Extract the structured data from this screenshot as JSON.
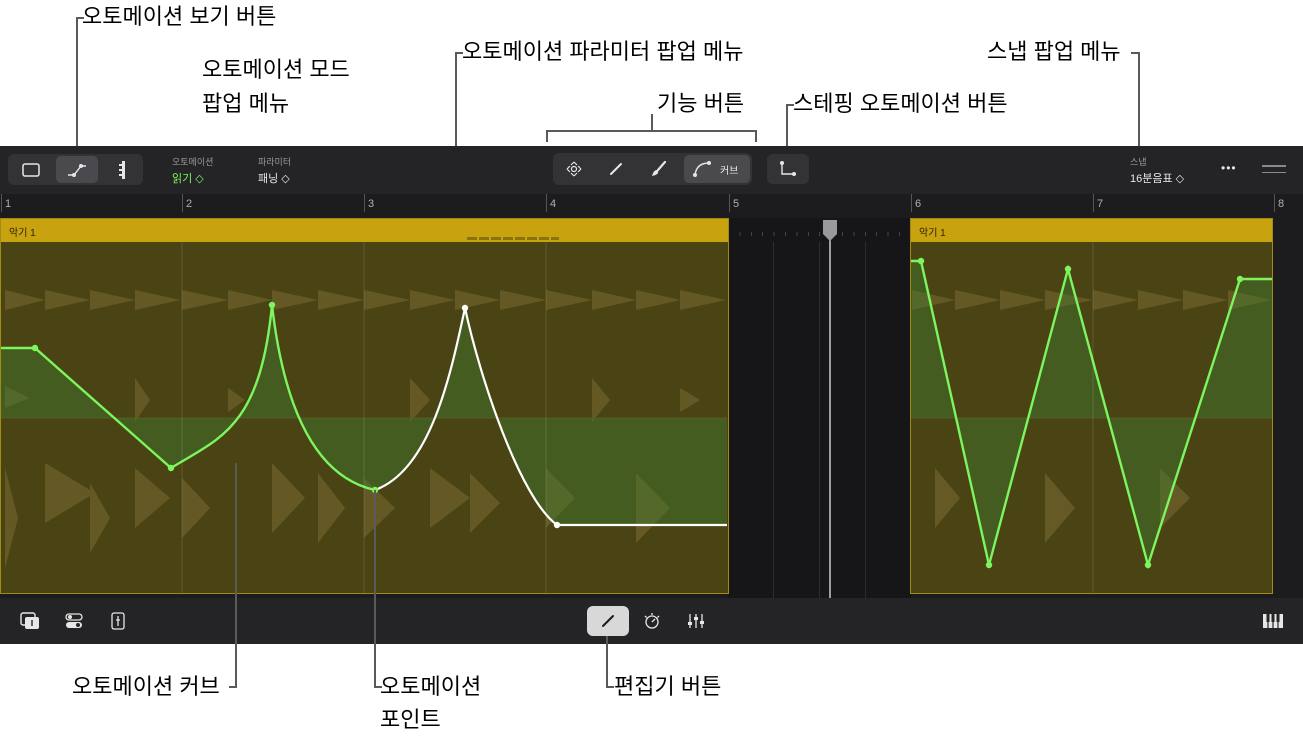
{
  "callouts": {
    "view_button": "오토메이션 보기 버튼",
    "mode_popup_line1": "오토메이션 모드",
    "mode_popup_line2": "팝업 메뉴",
    "parameter_popup": "오토메이션 파라미터 팝업 메뉴",
    "function_buttons": "기능 버튼",
    "stepping_button": "스테핑 오토메이션 버튼",
    "snap_popup": "스냅 팝업 메뉴",
    "curve": "오토메이션 커브",
    "point_line1": "오토메이션",
    "point_line2": "포인트",
    "editor_button": "편집기 버튼"
  },
  "toolbar": {
    "automation_label": "오토메이션",
    "automation_value": "읽기 ◇",
    "parameter_label": "파라미터",
    "parameter_value": "패닝 ◇",
    "curve_label": "커브",
    "snap_label": "스냅",
    "snap_value": "16분음표 ◇",
    "more": "•••"
  },
  "ruler": {
    "bars": [
      "1",
      "2",
      "3",
      "4",
      "5",
      "6",
      "7",
      "8"
    ]
  },
  "regions": [
    {
      "name": "악기 1"
    },
    {
      "name": "악기 1"
    }
  ],
  "colors": {
    "accent_green": "#7cf55e",
    "region_header": "#c9a20f",
    "region_body": "#4a4414",
    "app_bg": "#1c1c1e"
  },
  "icons": [
    "window-icon",
    "automation-icon",
    "piano-roll-icon",
    "move-icon",
    "pencil-icon",
    "brush-icon",
    "curve-icon",
    "step-icon",
    "browser-icon",
    "toggle-icon",
    "inspector-icon",
    "editor-icon",
    "metronome-icon",
    "mixer-icon",
    "keyboard-icon"
  ]
}
